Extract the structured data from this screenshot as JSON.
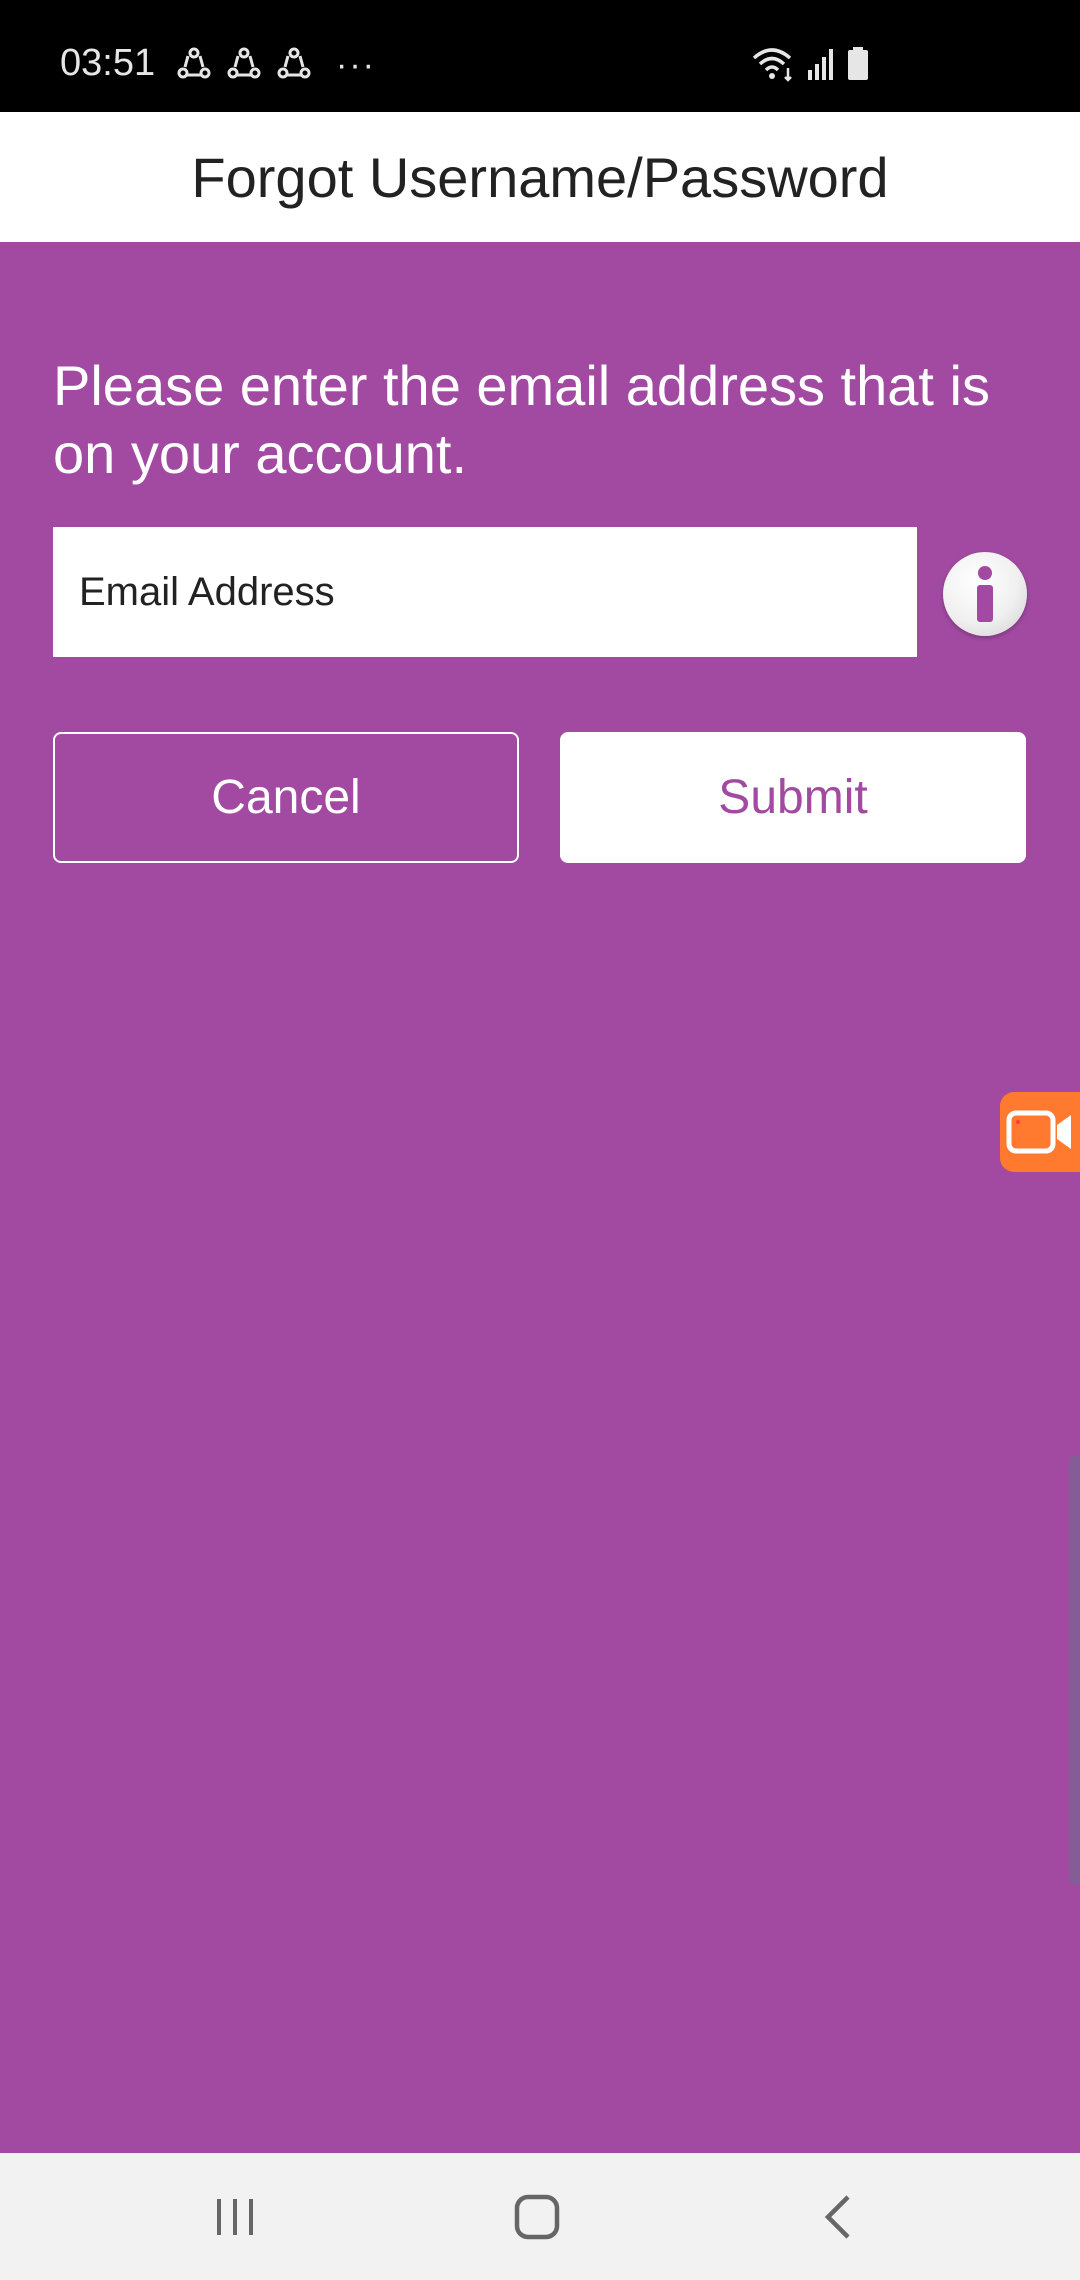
{
  "status_bar": {
    "time": "03:51",
    "left_icons": [
      "sync-icon",
      "sync-icon",
      "sync-icon"
    ],
    "more": "···",
    "right_icons": [
      "wifi-icon",
      "signal-icon",
      "battery-icon"
    ]
  },
  "header": {
    "title": "Forgot Username/Password"
  },
  "form": {
    "instructions": "Please enter the email address that is on your account.",
    "email_placeholder": "Email Address",
    "email_value": "",
    "info_icon": "info-icon"
  },
  "actions": {
    "cancel_label": "Cancel",
    "submit_label": "Submit"
  },
  "overlay": {
    "recorder_icon": "video-recorder-icon"
  },
  "navigation": {
    "items": [
      "recents-icon",
      "home-icon",
      "back-icon"
    ]
  },
  "colors": {
    "background": "#a24aa2",
    "header_bg": "#ffffff",
    "submit_text": "#a24aa2",
    "recorder": "#ff7a2f"
  }
}
